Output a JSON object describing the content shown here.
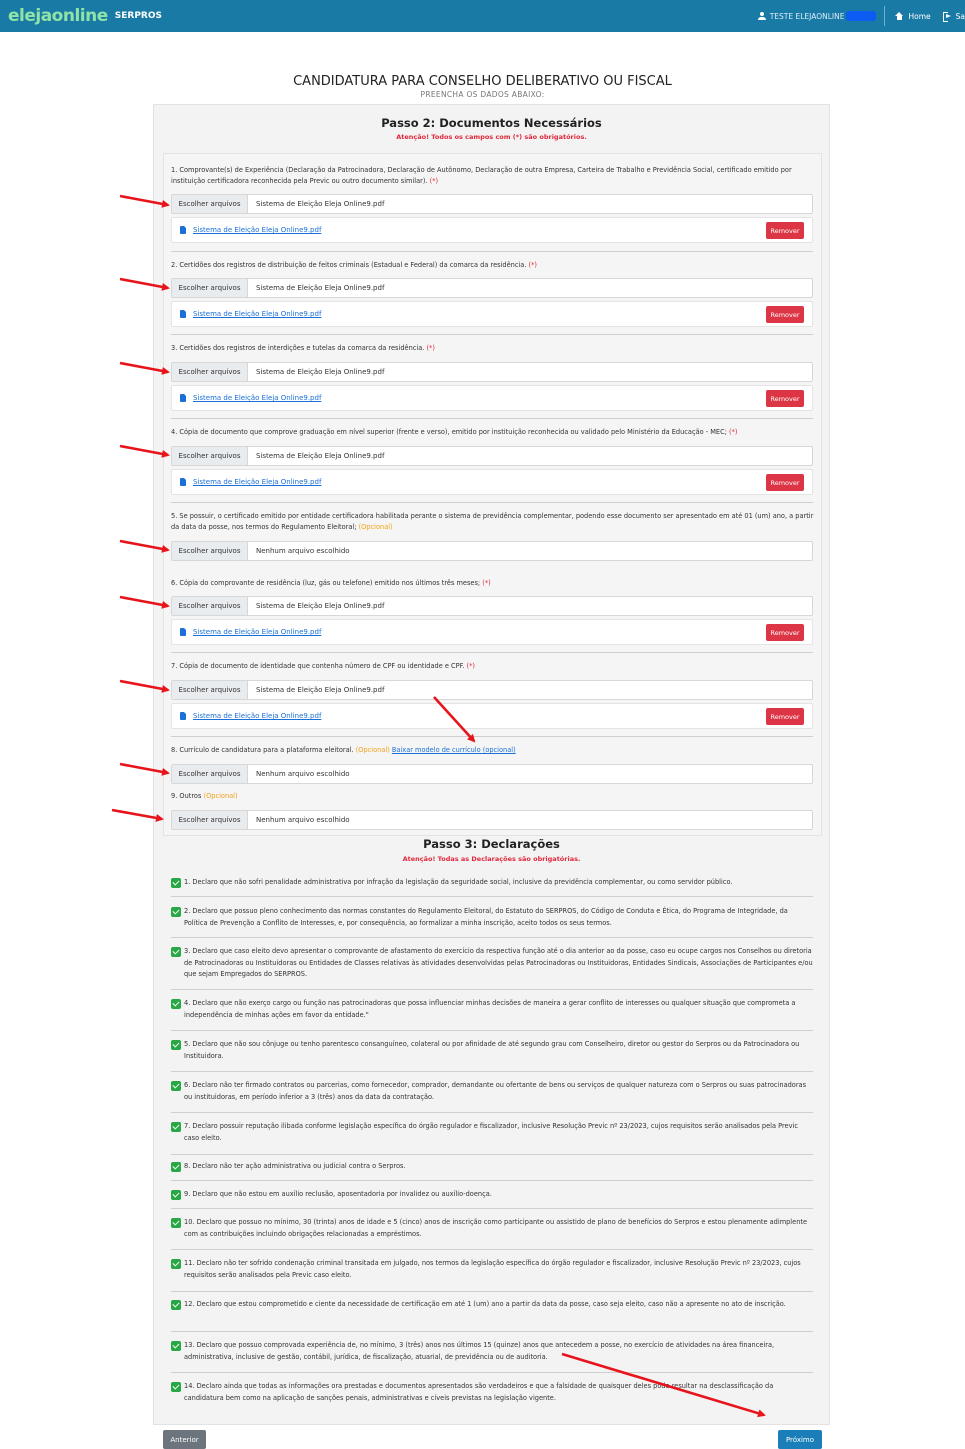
{
  "nav": {
    "brand_logo": "elejaonline",
    "brand_sub": "SERPROS",
    "user_label": "TESTE ELEJAONLINE",
    "home_label": "Home",
    "exit_label": "Sa"
  },
  "header": {
    "title": "CANDIDATURA PARA CONSELHO DELIBERATIVO OU FISCAL",
    "subtitle": "PREENCHA OS DADOS ABAIXO:"
  },
  "step2": {
    "heading": "Passo 2: Documentos Necessários",
    "warning": "Atenção! Todos os campos com (*) são obrigatórios.",
    "choose_label": "Escolher arquivos",
    "remove_label": "Remover",
    "required_mark": "(*)",
    "optional_mark": "(Opcional)",
    "download_link": "Baixar modelo de currículo (opcional)",
    "docs": [
      {
        "label": "1. Comprovante(s) de Experiência (Declaração da Patrocinadora, Declaração de Autônomo, Declaração de outra Empresa, Carteira de Trabalho e Previdência Social, certificado emitido por instituição certificadora reconhecida pela Previc ou outro documento similar).",
        "file": "Sistema de Eleição Eleja Online9.pdf",
        "link": "Sistema de Eleição Eleja Online9.pdf"
      },
      {
        "label": "2. Certidões dos registros de distribuição de feitos criminais (Estadual e Federal) da comarca da residência.",
        "file": "Sistema de Eleição Eleja Online9.pdf",
        "link": "Sistema de Eleição Eleja Online9.pdf"
      },
      {
        "label": "3. Certidões dos registros de interdições e tutelas da comarca da residência.",
        "file": "Sistema de Eleição Eleja Online9.pdf",
        "link": "Sistema de Eleição Eleja Online9.pdf"
      },
      {
        "label": "4. Cópia de documento que comprove graduação em nível superior (frente e verso), emitido por instituição reconhecida ou validado pelo Ministério da Educação - MEC;",
        "file": "Sistema de Eleição Eleja Online9.pdf",
        "link": "Sistema de Eleição Eleja Online9.pdf"
      },
      {
        "label": "5. Se possuir, o certificado emitido por entidade certificadora habilitada perante o sistema de previdência complementar, podendo esse documento ser apresentado em até 01 (um) ano, a partir da data da posse, nos termos do Regulamento Eleitoral;",
        "file": "Nenhum arquivo escolhido"
      },
      {
        "label": "6. Cópia do comprovante de residência (luz, gás ou telefone) emitido nos últimos três meses;",
        "file": "Sistema de Eleição Eleja Online9.pdf",
        "link": "Sistema de Eleição Eleja Online9.pdf"
      },
      {
        "label": "7. Cópia de documento de identidade que contenha número de CPF ou identidade e CPF.",
        "file": "Sistema de Eleição Eleja Online9.pdf",
        "link": "Sistema de Eleição Eleja Online9.pdf"
      },
      {
        "label": "8. Currículo de candidatura para a plataforma eleitoral.",
        "file": "Nenhum arquivo escolhido"
      },
      {
        "label": "9. Outros",
        "file": "Nenhum arquivo escolhido"
      }
    ]
  },
  "step3": {
    "heading": "Passo 3: Declarações",
    "warning": "Atenção! Todas as Declarações são obrigatórias.",
    "declarations": [
      "1. Declaro que não sofri penalidade administrativa por infração da legislação da seguridade social, inclusive da previdência complementar, ou como servidor público.",
      "2. Declaro que possuo pleno conhecimento das normas constantes do Regulamento Eleitoral, do Estatuto do SERPROS, do Código de Conduta e Ética, do Programa de Integridade, da Política de Prevenção a Conflito de Interesses, e, por consequência, ao formalizar a minha inscrição, aceito todos os seus termos.",
      "3. Declaro que caso eleito devo apresentar o comprovante de afastamento do exercício da respectiva função até o dia anterior ao da posse, caso eu ocupe cargos nos Conselhos ou diretoria de Patrocinadoras ou Instituidoras ou Entidades de Classes relativas às atividades desenvolvidas pelas Patrocinadoras ou Instituidoras, Entidades Sindicais, Associações de Participantes e/ou que sejam Empregados do SERPROS.",
      "4. Declaro que não exerço cargo ou função nas patrocinadoras que possa influenciar minhas decisões de maneira a gerar conflito de interesses ou qualquer situação que comprometa a independência de minhas ações em favor da entidade.\"",
      "5. Declaro que não sou cônjuge ou tenho parentesco consanguíneo, colateral ou por afinidade de até segundo grau com Conselheiro, diretor ou gestor do Serpros ou da Patrocinadora ou Instituidora.",
      "6. Declaro não ter firmado contratos ou parcerias, como fornecedor, comprador, demandante ou ofertante de bens ou serviços de qualquer natureza com o Serpros ou suas patrocinadoras ou instituidoras, em período inferior a 3 (três) anos da data da contratação.",
      "7. Declaro possuir reputação ilibada conforme legislação específica do órgão regulador e fiscalizador, inclusive Resolução Previc nº 23/2023, cujos requisitos serão analisados pela Previc caso eleito.",
      "8. Declaro não ter ação administrativa ou judicial contra o Serpros.",
      "9. Declaro que não estou em auxílio reclusão, aposentadoria por invalidez ou auxílio-doença.",
      "10. Declaro que possuo no mínimo, 30 (trinta) anos de idade e 5 (cinco) anos de inscrição como participante ou assistido de plano de benefícios do Serpros e estou plenamente adimplente com as contribuições incluindo obrigações relacionadas a empréstimos.",
      "11. Declaro não ter sofrido condenação criminal transitada em julgado, nos termos da legislação específica do órgão regulador e fiscalizador, inclusive Resolução Previc nº 23/2023, cujos requisitos serão analisados pela Previc caso eleito.",
      "12. Declaro que estou comprometido e ciente da necessidade de certificação em até 1 (um) ano a partir da data da posse, caso seja eleito, caso não a apresente no ato de inscrição.",
      "13. Declaro que possuo comprovada experiência de, no mínimo, 3 (três) anos nos últimos 15 (quinze) anos que antecedem a posse, no exercício de atividades na área financeira, administrativa, inclusive de gestão, contábil, jurídica, de fiscalização, atuarial, de previdência ou de auditoria.",
      "14. Declaro ainda que todas as informações ora prestadas e documentos apresentados são verdadeiros e que a falsidade de quaisquer deles pode resultar na desclassificação da candidatura bem como na aplicação de sanções penais, administrativas e cíveis previstas na legislação vigente."
    ]
  },
  "footer": {
    "prev_label": "Anterior",
    "next_label": "Próximo"
  },
  "colors": {
    "navbar": "#1a7aa6",
    "required": "#e0283c",
    "optional": "#f2a11a",
    "remove": "#dc3545",
    "check": "#28a745",
    "next": "#1a7fb8",
    "annotation_arrow": "#e8141c"
  }
}
